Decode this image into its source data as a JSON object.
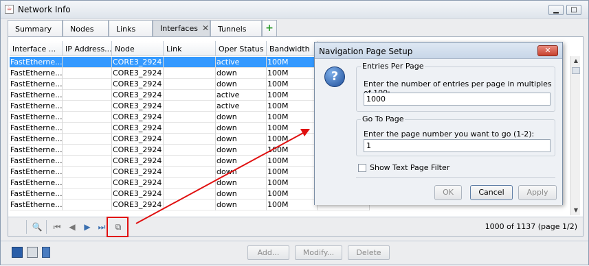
{
  "window": {
    "title": "Network Info",
    "minimize": "▁",
    "maximize": "□"
  },
  "tabs": [
    {
      "label": "Summary"
    },
    {
      "label": "Nodes"
    },
    {
      "label": "Links"
    },
    {
      "label": "Interfaces",
      "close": "✕"
    },
    {
      "label": "Tunnels"
    }
  ],
  "add_tab": "+",
  "table": {
    "columns": [
      "Interface ...",
      "IP Address...",
      "Node",
      "Link",
      "Oper Status",
      "Bandwidth"
    ],
    "rows": [
      [
        "FastEtherne...",
        "",
        "CORE3_2924",
        "",
        "active",
        "100M"
      ],
      [
        "FastEtherne...",
        "",
        "CORE3_2924",
        "",
        "down",
        "100M"
      ],
      [
        "FastEtherne...",
        "",
        "CORE3_2924",
        "",
        "down",
        "100M"
      ],
      [
        "FastEtherne...",
        "",
        "CORE3_2924",
        "",
        "active",
        "100M"
      ],
      [
        "FastEtherne...",
        "",
        "CORE3_2924",
        "",
        "active",
        "100M"
      ],
      [
        "FastEtherne...",
        "",
        "CORE3_2924",
        "",
        "down",
        "100M"
      ],
      [
        "FastEtherne...",
        "",
        "CORE3_2924",
        "",
        "down",
        "100M"
      ],
      [
        "FastEtherne...",
        "",
        "CORE3_2924",
        "",
        "down",
        "100M"
      ],
      [
        "FastEtherne...",
        "",
        "CORE3_2924",
        "",
        "down",
        "100M"
      ],
      [
        "FastEtherne...",
        "",
        "CORE3_2924",
        "",
        "down",
        "100M"
      ],
      [
        "FastEtherne...",
        "",
        "CORE3_2924",
        "",
        "down",
        "100M"
      ],
      [
        "FastEtherne...",
        "",
        "CORE3_2924",
        "",
        "down",
        "100M"
      ],
      [
        "FastEtherne...",
        "",
        "CORE3_2924",
        "",
        "down",
        "100M"
      ],
      [
        "FastEtherne...",
        "",
        "CORE3_2924",
        "",
        "down",
        "100M"
      ]
    ]
  },
  "pagination": {
    "info": "1000 of 1137 (page 1/2)"
  },
  "bottom_buttons": {
    "add": "Add...",
    "modify": "Modify...",
    "delete": "Delete"
  },
  "dialog": {
    "title": "Navigation Page Setup",
    "close": "✕",
    "entries_group": "Entries Per Page",
    "entries_prompt": "Enter the number of entries per page in multiples of 100:",
    "entries_value": "1000",
    "goto_group": "Go To Page",
    "goto_prompt": "Enter the page number you want to go (1-2):",
    "goto_value": "1",
    "filter_label": "Show Text Page Filter",
    "ok": "OK",
    "cancel": "Cancel",
    "apply": "Apply"
  },
  "colors": {
    "selection": "#3399ff",
    "annotation": "#e01010"
  }
}
